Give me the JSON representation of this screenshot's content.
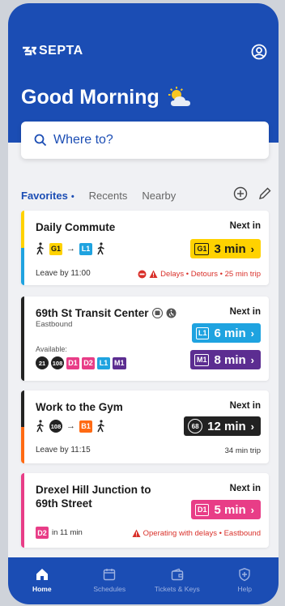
{
  "app": {
    "brand": "SEPTA",
    "greeting": "Good Morning"
  },
  "search": {
    "placeholder": "Where to?"
  },
  "tabs": [
    {
      "label": "Favorites"
    },
    {
      "label": "Recents"
    },
    {
      "label": "Nearby"
    }
  ],
  "colors": {
    "primary": "#1b4db4",
    "g1": "#ffd200",
    "l1": "#1fa3e0",
    "b1": "#ff6a13",
    "d": "#e83d87",
    "m1": "#5c2d91",
    "alert": "#d9302a"
  },
  "cards": [
    {
      "title": "Daily Commute",
      "next_label": "Next in",
      "route_chips": [
        "G1",
        "L1"
      ],
      "leave": "Leave by 11:00",
      "alert": "Delays • Detours • 25 min trip",
      "pill": {
        "route": "G1",
        "time": "3 min"
      }
    },
    {
      "title": "69th St Transit Center",
      "subtitle": "Eastbound",
      "next_label": "Next in",
      "available_label": "Available:",
      "available": [
        "21",
        "108",
        "D1",
        "D2",
        "L1",
        "M1"
      ],
      "pills": [
        {
          "route": "L1",
          "time": "6 min"
        },
        {
          "route": "M1",
          "time": "8 min"
        }
      ]
    },
    {
      "title": "Work to the Gym",
      "next_label": "Next in",
      "route_chips": [
        "108",
        "B1"
      ],
      "leave": "Leave by 11:15",
      "trip": "34 min trip",
      "pill": {
        "route": "68",
        "time": "12 min"
      }
    },
    {
      "title_line1": "Drexel Hill Junction to",
      "title_line2": "69th Street",
      "next_label": "Next in",
      "route": "D2",
      "route_time": "in 11 min",
      "alert": "Operating with delays • Eastbound",
      "pill": {
        "route": "D1",
        "time": "5 min"
      }
    }
  ],
  "tabbar": [
    {
      "label": "Home",
      "icon": "home-icon"
    },
    {
      "label": "Schedules",
      "icon": "calendar-icon"
    },
    {
      "label": "Tickets & Keys",
      "icon": "wallet-icon"
    },
    {
      "label": "Help",
      "icon": "shield-icon"
    }
  ]
}
